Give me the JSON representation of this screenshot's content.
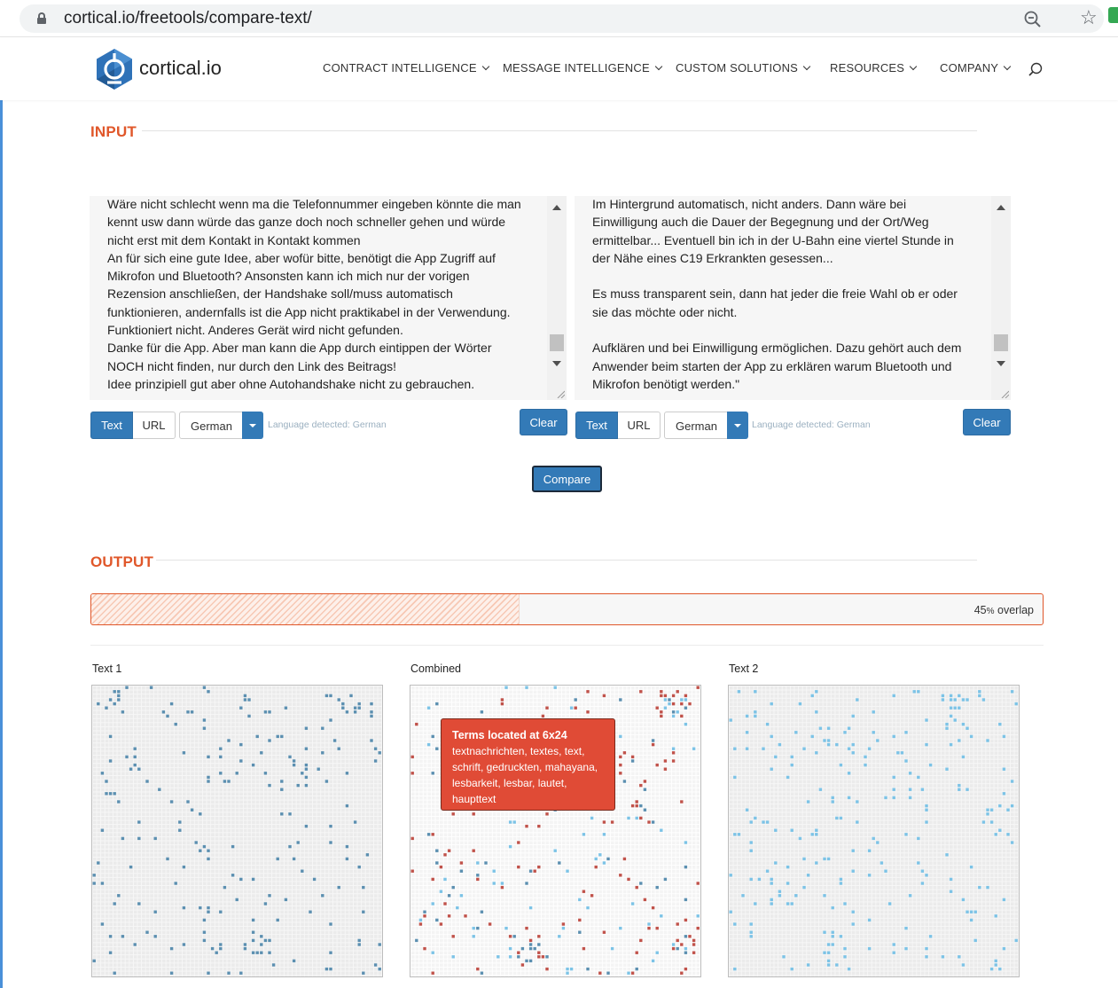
{
  "browser": {
    "url": "cortical.io/freetools/compare-text/"
  },
  "header": {
    "logo_text": "cortical.io",
    "nav": [
      {
        "label": "CONTRACT INTELLIGENCE"
      },
      {
        "label": "MESSAGE INTELLIGENCE"
      },
      {
        "label": "CUSTOM SOLUTIONS"
      },
      {
        "label": "RESOURCES"
      },
      {
        "label": "COMPANY"
      }
    ]
  },
  "input": {
    "title": "INPUT",
    "left": {
      "text": "Wäre nicht schlecht wenn ma die Telefonnummer eingeben könnte die man\nkennt usw dann würde das ganze doch noch schneller gehen und würde\nnicht erst mit dem Kontakt in Kontakt kommen\nAn für sich eine gute Idee, aber wofür bitte, benötigt die App Zugriff auf\nMikrofon und Bluetooth? Ansonsten kann ich mich nur der vorigen\nRezension anschließen, der Handshake soll/muss automatisch\nfunktionieren, andernfalls ist die App nicht praktikabel in der Verwendung.\nFunktioniert nicht. Anderes Gerät wird nicht gefunden.\nDanke für die App. Aber man kann die App durch eintippen der Wörter\nNOCH nicht finden, nur durch den Link des Beitrags!\nIdee prinzipiell gut aber ohne Autohandshake nicht zu gebrauchen.",
      "text_btn": "Text",
      "url_btn": "URL",
      "language": "German",
      "detected": "Language detected: German",
      "clear": "Clear"
    },
    "right": {
      "text": "Im Hintergrund automatisch, nicht anders. Dann wäre bei\nEinwilligung auch die Dauer der Begegnung und der Ort/Weg\nermittelbar... Eventuell bin ich in der U-Bahn eine viertel Stunde in\nder Nähe eines C19 Erkrankten gesessen...\n\nEs muss transparent sein, dann hat jeder die freie Wahl ob er oder\nsie das möchte oder nicht.\n\nAufklären und bei Einwilligung ermöglichen. Dazu gehört auch dem\nAnwender beim starten der App zu erklären warum Bluetooth und\nMikrofon benötigt werden.\"",
      "text_btn": "Text",
      "url_btn": "URL",
      "language": "German",
      "detected": "Language detected: German",
      "clear": "Clear"
    },
    "compare": "Compare"
  },
  "output": {
    "title": "OUTPUT",
    "overlap_percent": 45,
    "overlap_number": "45",
    "overlap_unit": "%",
    "overlap_suffix": "overlap",
    "panels": [
      "Text 1",
      "Combined",
      "Text 2"
    ],
    "tooltip": {
      "title": "Terms located at 6x24",
      "terms": "textnachrichten, textes, text, schrift, gedruckten, mahayana, lesbarkeit, lesbar, lautet, haupttext"
    }
  },
  "colors": {
    "accent": "#e0572a",
    "primary": "#337ab7",
    "text1_dots": "#5b8fb0",
    "text2_dots": "#7cc3e6",
    "overlap_dots": "#c0524a",
    "tooltip_bg": "#e04b36"
  }
}
